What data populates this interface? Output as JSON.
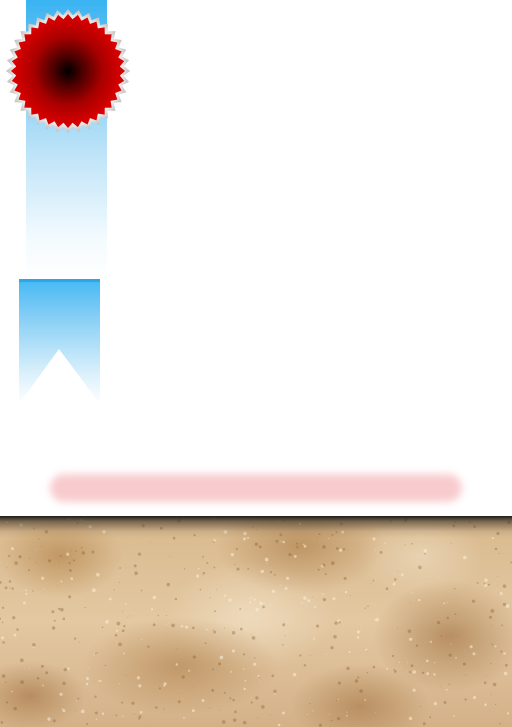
{
  "colors": {
    "ribbon_top": "#39b3f2",
    "ribbon_fade": "#ffffff",
    "seal_outer": "#d40000",
    "seal_center": "#000000",
    "seal_rim": "#c8c8c8",
    "bar": "#f7c2c6",
    "parchment": "#dcc09a"
  },
  "icons": {
    "seal": "award-seal-icon",
    "ribbon": "ribbon-icon"
  }
}
